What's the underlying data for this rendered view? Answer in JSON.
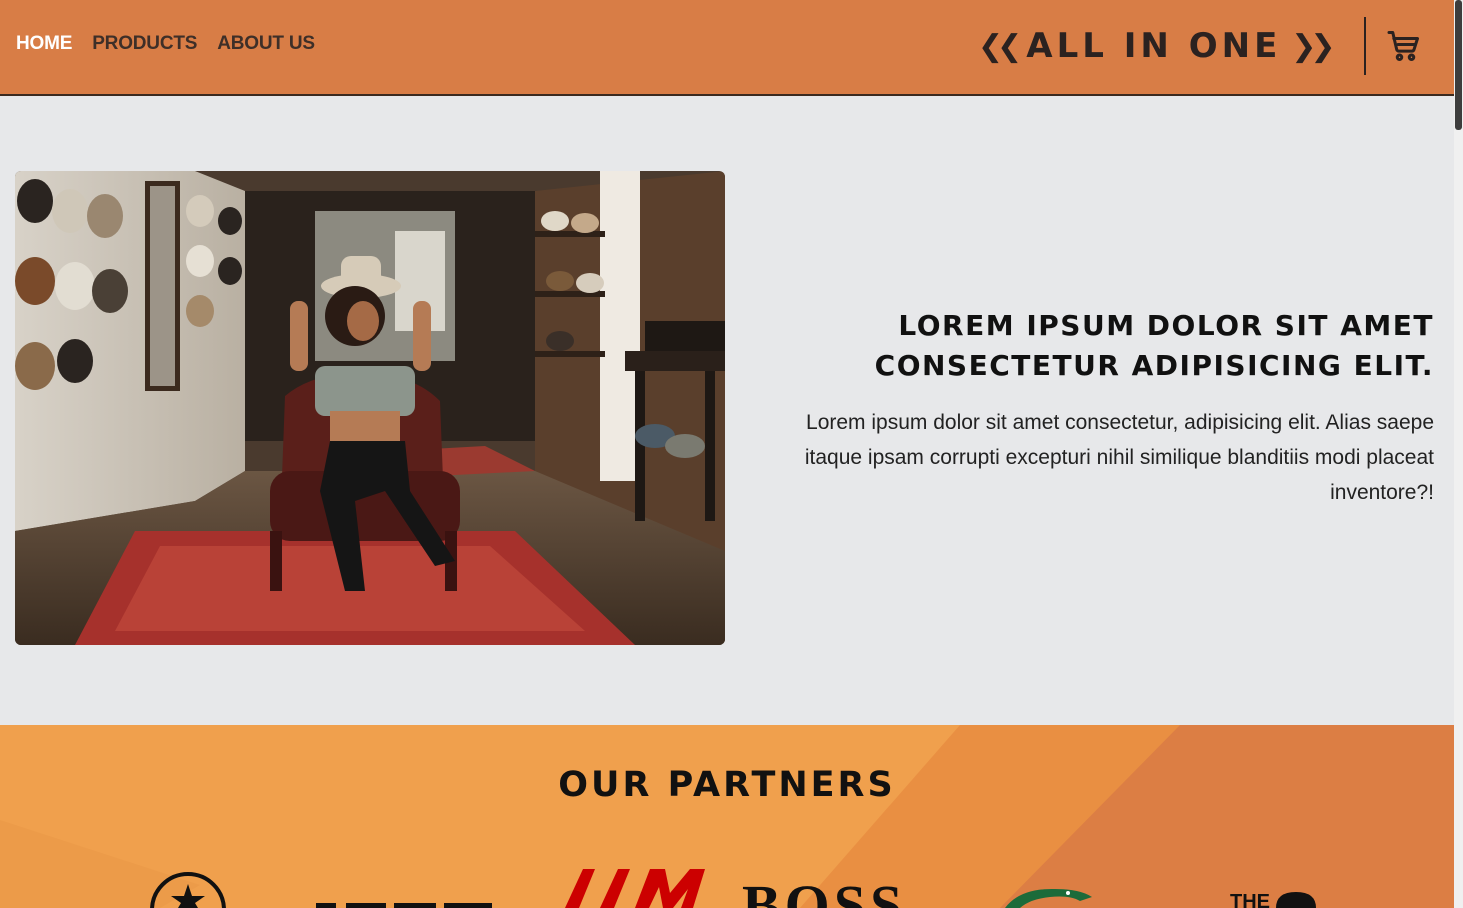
{
  "nav": {
    "items": [
      {
        "label": "HOME",
        "active": true
      },
      {
        "label": "PRODUCTS",
        "active": false
      },
      {
        "label": "ABOUT US",
        "active": false
      }
    ]
  },
  "logo": {
    "text": "ALL IN ONE",
    "left_mark": "❮❮",
    "right_mark": "❯❯"
  },
  "cart": {
    "icon": "cart-icon"
  },
  "hero": {
    "title_line1": "LOREM IPSUM DOLOR SIT AMET",
    "title_line2": "CONSECTETUR ADIPISICING ELIT.",
    "text": "Lorem ipsum dolor sit amet consectetur, adipisicing elit. Alias saepe itaque ipsam corrupti excepturi nihil similique blanditiis modi placeat inventore?!",
    "image": "woman-in-hat-shop-photo"
  },
  "partners": {
    "title": "OUR PARTNERS",
    "logos": [
      "converse-logo",
      "esprit-logo",
      "hm-logo",
      "boss-logo",
      "lacoste-logo",
      "the-north-face-logo"
    ]
  },
  "colors": {
    "header": "#d87d46",
    "partners_bg": "#f0a04d",
    "page_bg": "#e7e8ea",
    "hm_red": "#cc0000",
    "lacoste_green": "#1c6b3a"
  }
}
